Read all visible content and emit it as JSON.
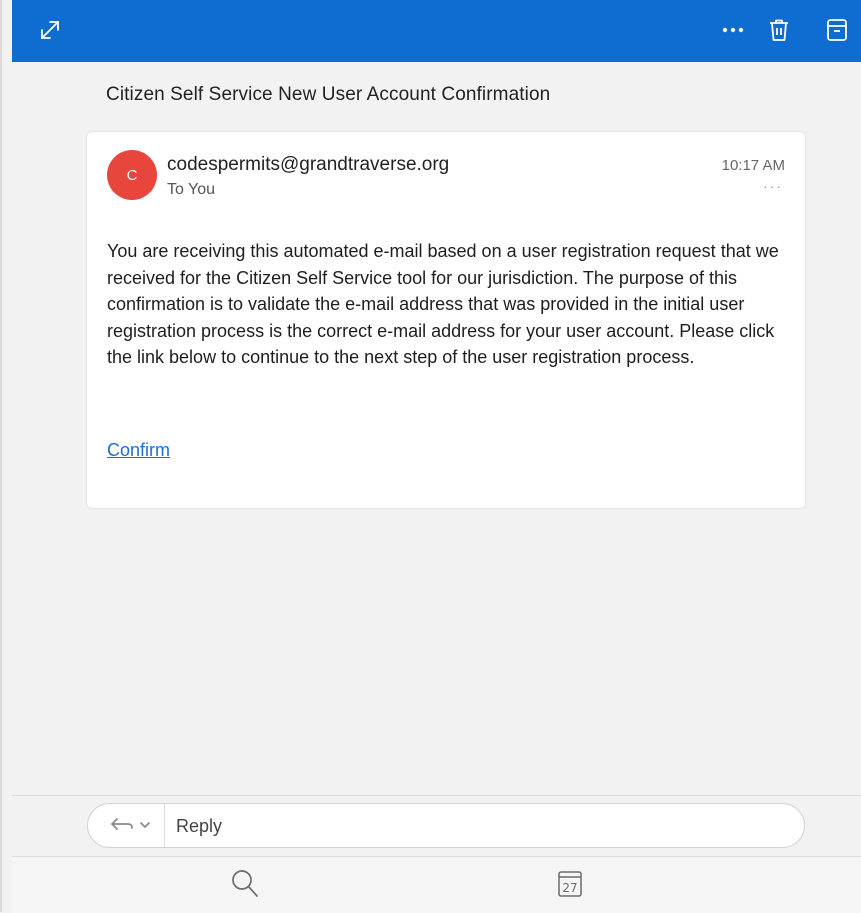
{
  "toolbar": {
    "expand_icon": "expand-icon",
    "more_icon": "more-options-icon",
    "delete_icon": "trash-icon",
    "archive_icon": "archive-icon"
  },
  "email": {
    "subject": "Citizen Self Service New User Account Confirmation",
    "avatar_letter": "C",
    "sender": "codespermits@grandtraverse.org",
    "recipient": "To You",
    "time": "10:17 AM",
    "details_dots": "···",
    "body": "You are receiving this automated e-mail based on a user registration request that we received for the Citizen Self Service tool for our jurisdiction. The purpose of this confirmation is to validate the e-mail address that was provided in the initial user registration process is the correct e-mail address for your user account. Please click the link below to continue to the next step of the user registration process.",
    "link_label": "Confirm"
  },
  "reply": {
    "placeholder": "Reply"
  },
  "bottom_nav": {
    "calendar_day": "27"
  },
  "colors": {
    "header": "#0f6cd0",
    "avatar": "#e8453c",
    "link": "#1a6fd6"
  }
}
